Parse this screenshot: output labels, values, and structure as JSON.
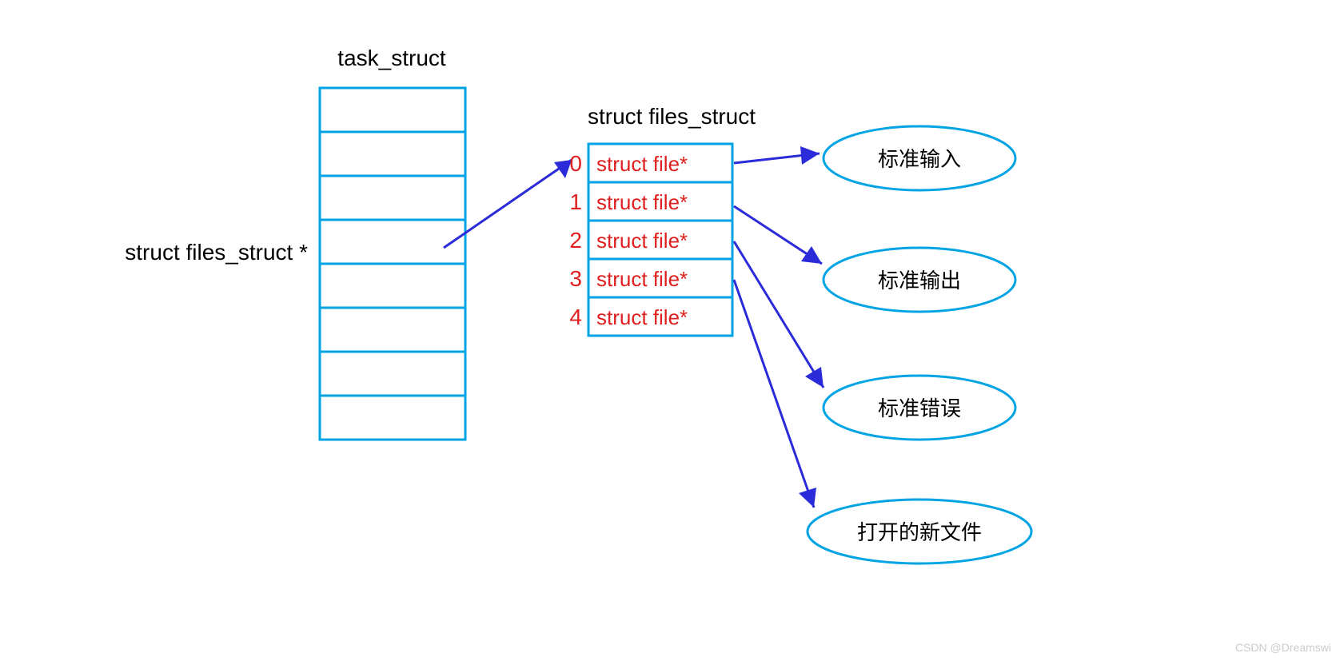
{
  "titles": {
    "task_struct": "task_struct",
    "files_struct": "struct files_struct"
  },
  "label": {
    "pointer": "struct files_struct  *"
  },
  "fd_table": [
    {
      "idx": "0",
      "content": "struct file*"
    },
    {
      "idx": "1",
      "content": "struct file*"
    },
    {
      "idx": "2",
      "content": "struct file*"
    },
    {
      "idx": "3",
      "content": "struct file*"
    },
    {
      "idx": "4",
      "content": "struct file*"
    }
  ],
  "targets": {
    "t0": "标准输入",
    "t1": "标准输出",
    "t2": "标准错误",
    "t3": "打开的新文件"
  },
  "watermark": "CSDN @Dreamswi"
}
